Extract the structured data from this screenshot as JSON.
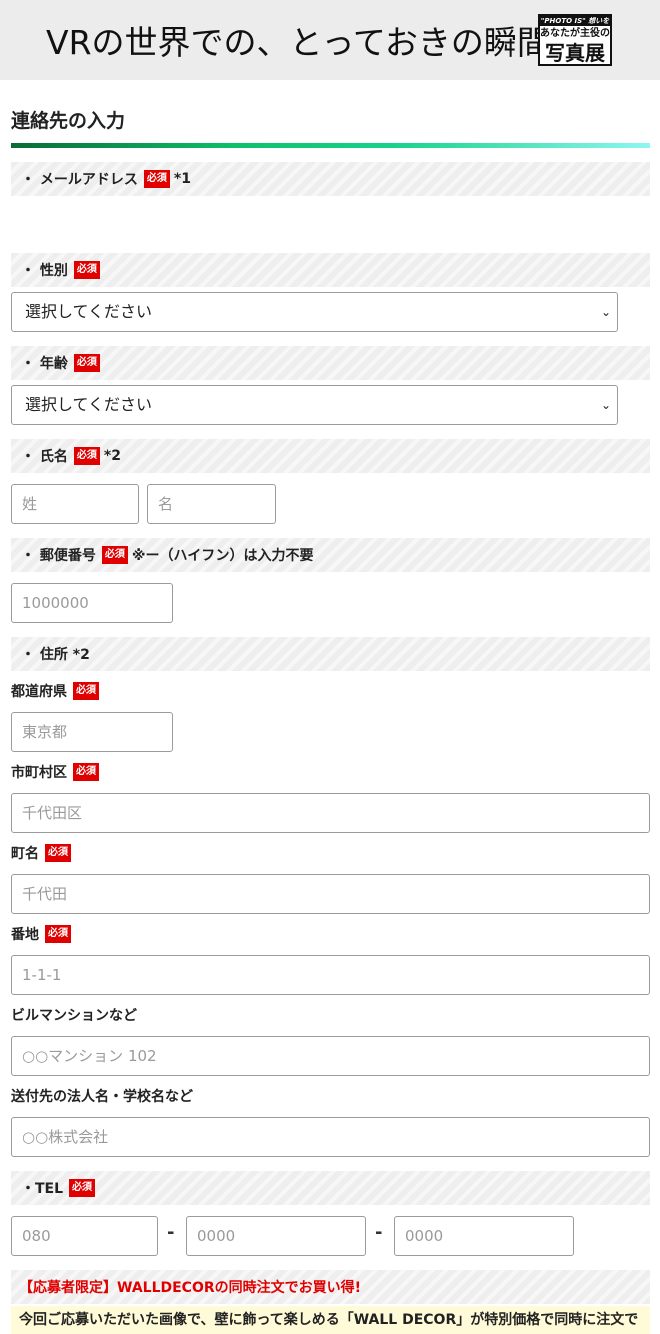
{
  "header": {
    "title": "VRの世界での、とっておきの瞬間",
    "logo_line1": "\"PHOTO IS\" 想いをつなぐ。",
    "logo_line2": "あなたが主役の",
    "logo_line3": "写真展"
  },
  "section_title": "連絡先の入力",
  "required_badge": "必須",
  "email": {
    "label": "・ メールアドレス",
    "note": "*1"
  },
  "gender": {
    "label": "・ 性別",
    "selected": "選択してください"
  },
  "age": {
    "label": "・ 年齢",
    "selected": "選択してください"
  },
  "name": {
    "label": "・ 氏名",
    "note": "*2",
    "last_placeholder": "姓",
    "first_placeholder": "名"
  },
  "postal": {
    "label": "・ 郵便番号",
    "note": "※ー（ハイフン）は入力不要",
    "placeholder": "1000000"
  },
  "address": {
    "label": "・ 住所 *2",
    "prefecture": {
      "label": "都道府県",
      "placeholder": "東京都"
    },
    "city": {
      "label": "市町村区",
      "placeholder": "千代田区"
    },
    "town": {
      "label": "町名",
      "placeholder": "千代田"
    },
    "block": {
      "label": "番地",
      "placeholder": "1-1-1"
    },
    "building": {
      "label": "ビルマンションなど",
      "placeholder": "○○マンション 102"
    },
    "company": {
      "label": "送付先の法人名・学校名など",
      "placeholder": "○○株式会社"
    }
  },
  "tel": {
    "label": "・TEL",
    "part1": "080",
    "part2": "0000",
    "part3": "0000",
    "separator": "-"
  },
  "promo": {
    "title": "【応募者限定】WALLDECORの同時注文でお買い得!",
    "text": "今回ご応募いただいた画像で、壁に飾って楽しめる「WALL DECOR」が特別価格で同時に注文で"
  },
  "chevron_icon": "chevron-down-icon"
}
